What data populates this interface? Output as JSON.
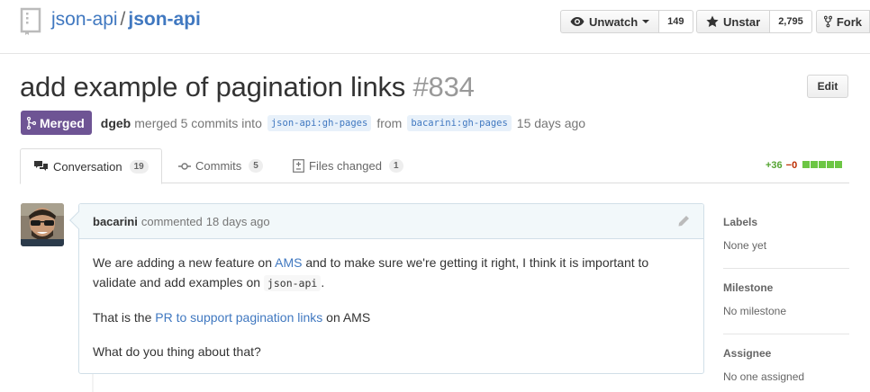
{
  "repo": {
    "owner": "json-api",
    "separator": "/",
    "name": "json-api"
  },
  "actions": {
    "watch_label": "Unwatch",
    "watch_count": "149",
    "star_label": "Unstar",
    "star_count": "2,795",
    "fork_label": "Fork"
  },
  "pr": {
    "title": "add example of pagination links",
    "number": "#834",
    "edit_label": "Edit",
    "state_label": "Merged",
    "author": "dgeb",
    "merged_text": "merged 5 commits into",
    "base_branch": "json-api:gh-pages",
    "from_text": "from",
    "head_branch": "bacarini:gh-pages",
    "time": "15 days ago"
  },
  "tabs": [
    {
      "label": "Conversation",
      "count": "19",
      "icon": "comment-discussion-icon"
    },
    {
      "label": "Commits",
      "count": "5",
      "icon": "git-commit-icon"
    },
    {
      "label": "Files changed",
      "count": "1",
      "icon": "diff-icon"
    }
  ],
  "diffstat": {
    "additions": "+36",
    "deletions": "−0",
    "blocks": 5
  },
  "comment": {
    "author": "bacarini",
    "action": "commented",
    "time": "18 days ago",
    "p1_before": "We are adding a new feature on ",
    "p1_link": "AMS",
    "p1_middle": " and to make sure we're getting it right, I think it is important to validate and add examples on ",
    "p1_code": "json-api",
    "p1_after": ".",
    "p2_before": "That is the ",
    "p2_link": "PR to support pagination links",
    "p2_after": " on AMS",
    "p3": "What do you thing about that?"
  },
  "sidebar": {
    "labels_title": "Labels",
    "labels_value": "None yet",
    "milestone_title": "Milestone",
    "milestone_value": "No milestone",
    "assignee_title": "Assignee",
    "assignee_value": "No one assigned"
  },
  "colors": {
    "link": "#4078c0",
    "merged": "#6e5494",
    "additions": "#55a532",
    "deletions": "#bd2c00"
  }
}
